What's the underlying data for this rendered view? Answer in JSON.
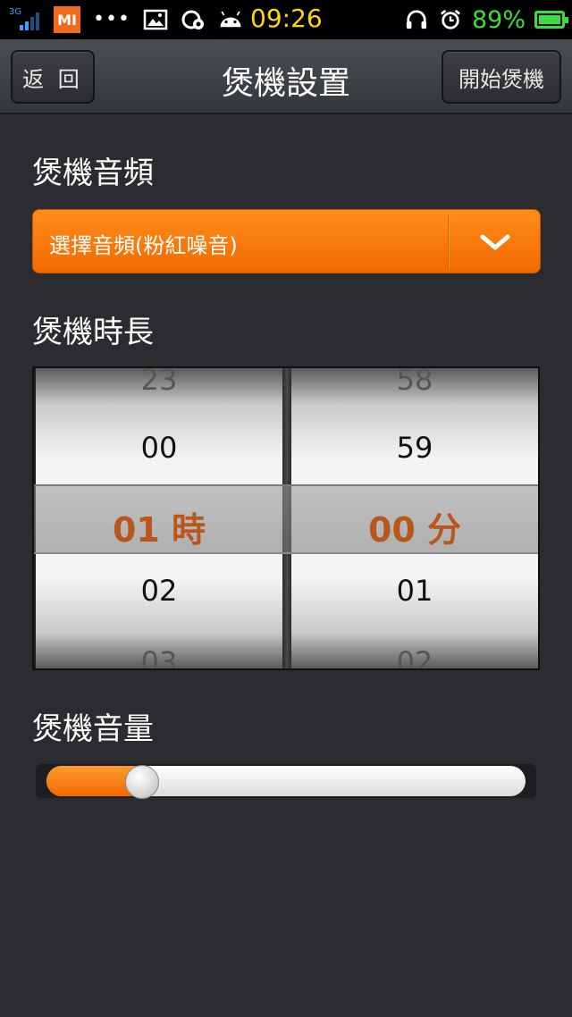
{
  "status_bar": {
    "network": "3G",
    "carrier_icon": "MI",
    "overflow": "•••",
    "time": "09:26",
    "battery_percent": "89%",
    "battery_level": 0.89,
    "icons": [
      "signal-icon",
      "mi-icon",
      "more-dots-icon",
      "image-icon",
      "sync-icon",
      "android-icon",
      "headphones-icon",
      "alarm-icon",
      "battery-icon"
    ]
  },
  "titlebar": {
    "back_label": "返 回",
    "title": "煲機設置",
    "start_label": "開始煲機"
  },
  "audio_section": {
    "label": "煲機音頻",
    "dropdown_value": "選擇音頻(粉紅噪音)"
  },
  "duration_section": {
    "label": "煲機時長",
    "hours": {
      "items": [
        "23",
        "00",
        "02",
        "03"
      ],
      "selected": "01 時"
    },
    "minutes": {
      "items": [
        "58",
        "59",
        "01",
        "02"
      ],
      "selected": "00 分"
    }
  },
  "volume_section": {
    "label": "煲機音量",
    "volume_level": 0.2
  },
  "colors": {
    "accent": "#f26a00",
    "selected_text": "#b8561c",
    "background": "#2a2c2f"
  }
}
